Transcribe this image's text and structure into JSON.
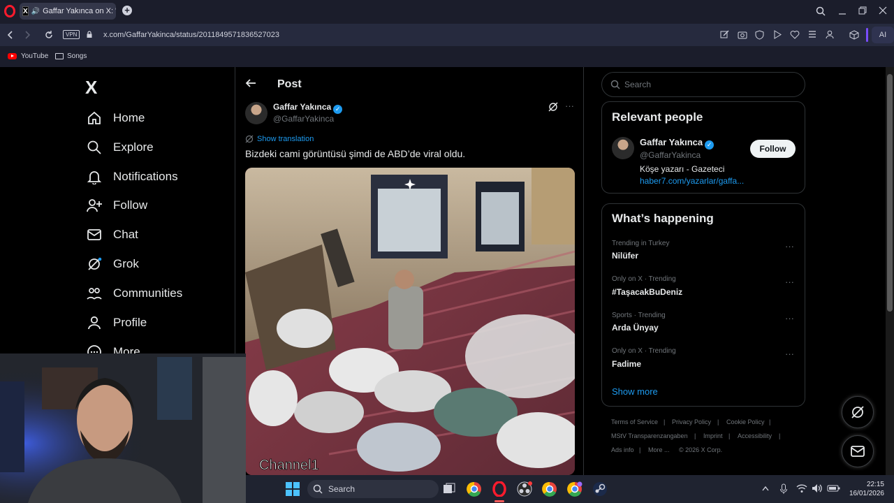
{
  "browser": {
    "tab_title": "Gaffar Yakınca on X: \"B",
    "url": "x.com/GaffarYakinca/status/2011849571836527023",
    "vpn_label": "VPN",
    "ai_label": "AI",
    "bookmarks": [
      {
        "label": "YouTube",
        "icon": "youtube-icon"
      },
      {
        "label": "Songs",
        "icon": "folder-icon"
      }
    ]
  },
  "sidebar": {
    "logo": "X",
    "items": [
      {
        "label": "Home",
        "icon": "home-icon"
      },
      {
        "label": "Explore",
        "icon": "search-icon"
      },
      {
        "label": "Notifications",
        "icon": "bell-icon"
      },
      {
        "label": "Follow",
        "icon": "add-person-icon"
      },
      {
        "label": "Chat",
        "icon": "mail-icon"
      },
      {
        "label": "Grok",
        "icon": "grok-icon"
      },
      {
        "label": "Communities",
        "icon": "communities-icon"
      },
      {
        "label": "Profile",
        "icon": "person-icon"
      },
      {
        "label": "More",
        "icon": "more-circle-icon"
      }
    ]
  },
  "post": {
    "header_title": "Post",
    "author_name": "Gaffar Yakınca",
    "author_handle": "@GaffarYakinca",
    "show_translation": "Show translation",
    "text": "Bizdeki cami görüntüsü şimdi de ABD’de viral oldu.",
    "media_watermark": "Channel1"
  },
  "right": {
    "search_placeholder": "Search",
    "relevant_title": "Relevant people",
    "relevant_person": {
      "name": "Gaffar Yakınca",
      "handle": "@GaffarYakinca",
      "bio": "Köşe yazarı - Gazeteci",
      "link": "haber7.com/yazarlar/gaffa...",
      "follow_label": "Follow"
    },
    "happening_title": "What’s happening",
    "trends": [
      {
        "context": "Trending in Turkey",
        "name": "Nilüfer"
      },
      {
        "context": "Only on X · Trending",
        "name": "#TaşacakBuDeniz"
      },
      {
        "context": "Sports · Trending",
        "name": "Arda Ünyay"
      },
      {
        "context": "Only on X · Trending",
        "name": "Fadime"
      }
    ],
    "show_more": "Show more",
    "footer": {
      "terms": "Terms of Service",
      "privacy": "Privacy Policy",
      "cookie": "Cookie Policy",
      "mstv": "MStV Transparenzangaben",
      "imprint": "Imprint",
      "accessibility": "Accessibility",
      "ads": "Ads info",
      "more": "More ...",
      "copyright": "© 2026 X Corp."
    }
  },
  "taskbar": {
    "search_label": "Search",
    "time": "22:15",
    "date": "16/01/2026"
  },
  "colors": {
    "accent": "#1d9bf0",
    "opera_red": "#ff1b2d",
    "background": "#000000",
    "browser_chrome": "#1b1d2b"
  }
}
